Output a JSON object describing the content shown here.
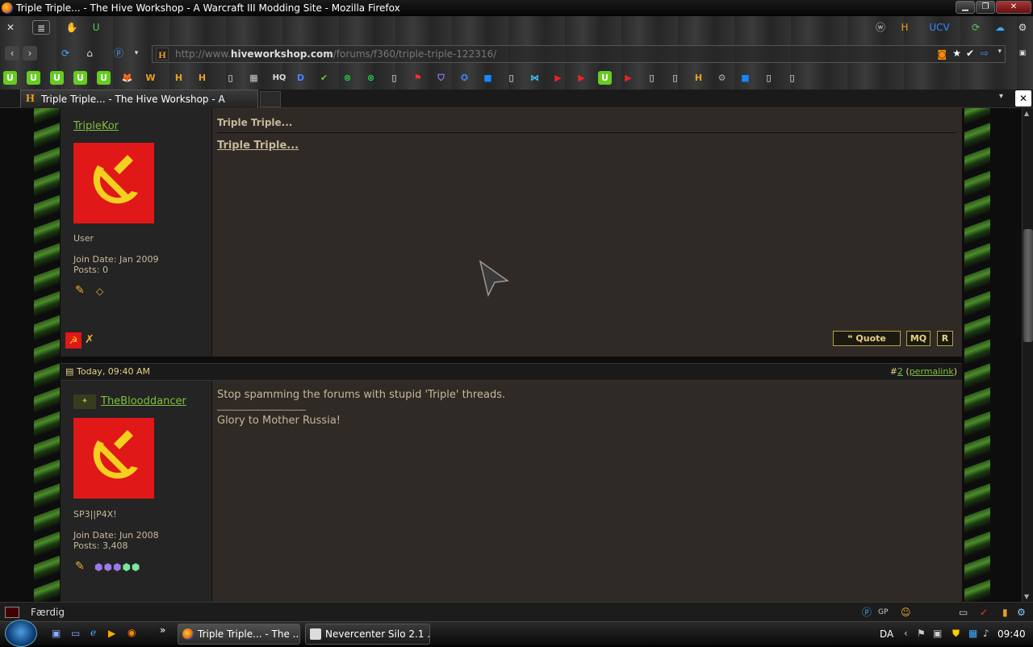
{
  "window": {
    "title": "Triple Triple... - The Hive Workshop - A Warcraft III Modding Site - Mozilla Firefox"
  },
  "nav": {
    "url_prefix": "http://www.",
    "url_domain": "hiveworkshop.com",
    "url_path": "/forums/f360/triple-triple-122316/",
    "site_icon": "H"
  },
  "bookmarks": [
    "U",
    "U",
    "U",
    "U",
    "U",
    "fox-icon",
    "W",
    "H",
    "H",
    "page-icon",
    "film-icon",
    "HQ",
    "D",
    "check-icon",
    "xbox-icon",
    "xbox-icon",
    "page-icon",
    "flag-icon",
    "shield-icon",
    "swirl-icon",
    "blue-square",
    "page-icon",
    "butterfly-icon",
    "YouTube",
    "YouTube",
    "U",
    "YouTube",
    "page-icon",
    "page-icon",
    "H",
    "gear-icon",
    "blue-square",
    "page-icon",
    "page-icon"
  ],
  "tab": {
    "title": "Triple Triple... - The Hive Workshop - A Warc..."
  },
  "post1": {
    "username": "TripleKor",
    "rank": "User",
    "join_date": "Join Date: Jan 2009",
    "posts": "Posts: 0",
    "title": "Triple Triple...",
    "body_link": "Triple Triple...",
    "btn_quote": "Quote",
    "btn_mq": "MQ",
    "btn_r": "R"
  },
  "post2": {
    "date": "Today, 09:40 AM",
    "post_no_prefix": "#",
    "post_no": "2",
    "permalink": "permalink",
    "username": "TheBlooddancer",
    "rank": "SP3||P4X!",
    "join_date": "Join Date: Jun 2008",
    "posts": "Posts: 3,408",
    "body": "Stop spamming the forums with stupid 'Triple' threads.",
    "signature_rule": "____________________",
    "signature": "Glory to Mother Russia!"
  },
  "statusbar": {
    "text": "Færdig"
  },
  "taskbar": {
    "items": [
      {
        "label": "Triple Triple... - The ..."
      },
      {
        "label": "Nevercenter Silo 2.1 ..."
      }
    ],
    "language": "DA",
    "time": "09:40"
  },
  "colors": {
    "accent_green": "#7fbf3f",
    "flag_red": "#e01818",
    "hammer_yellow": "#f5d020",
    "button_gold": "#e8d080"
  }
}
